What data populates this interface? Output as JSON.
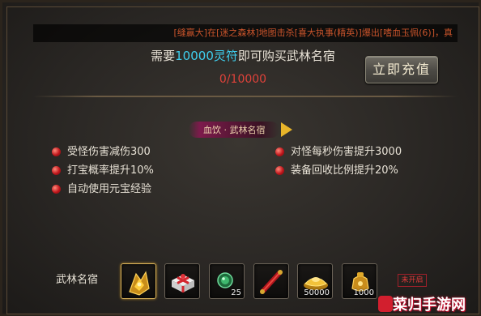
{
  "ticker": {
    "text": "[缝赢大]在[迷之森林]地图击杀[喜大执事(精英)]爆出[嗜血玉佩(6)]，真"
  },
  "header": {
    "prefix": "需要",
    "amount": "10000灵符",
    "suffix": "即可购买武林名宿",
    "progress": "0/10000",
    "highlight_color": "#3fd0ef",
    "progress_color": "#e0423a"
  },
  "recharge_button": {
    "label": "立即充值"
  },
  "ribbon": {
    "title": "血饮 · 武林名宿"
  },
  "stats": {
    "left": [
      "受怪伤害减伤300",
      "打宝概率提升10%",
      "自动使用元宝经验"
    ],
    "right": [
      "对怪每秒伤害提升3000",
      "装备回收比例提升20%"
    ]
  },
  "rewards": {
    "label": "武林名宿",
    "items": [
      {
        "icon": "golden-armor-icon",
        "count": ""
      },
      {
        "icon": "gift-box-icon",
        "count": ""
      },
      {
        "icon": "green-gem-icon",
        "count": "25"
      },
      {
        "icon": "red-scroll-icon",
        "count": ""
      },
      {
        "icon": "gold-ingot-icon",
        "count": "50000"
      },
      {
        "icon": "gold-pouch-icon",
        "count": "1000"
      }
    ],
    "status": "未开启"
  },
  "watermark": {
    "text": "菜归手游网"
  }
}
